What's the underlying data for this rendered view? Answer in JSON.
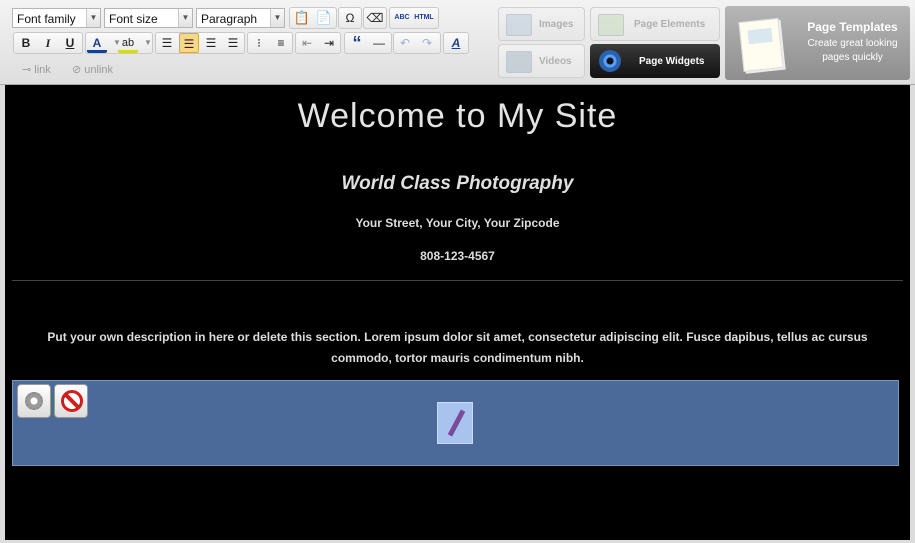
{
  "toolbar": {
    "font_family": "Font family",
    "font_size": "Font size",
    "block_format": "Paragraph",
    "html_label": "HTML",
    "abc_label": "ABC",
    "bold": "B",
    "italic": "I",
    "underline": "U",
    "font_color": "A",
    "highlight": "ab",
    "blockquote": "“",
    "hr": "—",
    "clean": "A",
    "link": "link",
    "unlink": "unlink"
  },
  "panels": {
    "images": "Images",
    "videos": "Videos",
    "page_elements": "Page Elements",
    "page_widgets": "Page Widgets",
    "templates_title": "Page Templates",
    "templates_desc": "Create great looking pages quickly"
  },
  "page": {
    "title": "Welcome to My Site",
    "subtitle": "World Class Photography",
    "address": "Your Street, Your City, Your Zipcode",
    "phone": "808-123-4567",
    "description": "Put your own description in here or delete this section. Lorem ipsum dolor sit amet, consectetur adipiscing elit. Fusce dapibus, tellus ac cursus commodo, tortor mauris condimentum nibh."
  },
  "colors": {
    "canvas_bg": "#000000",
    "widget_bg": "#4b6a9a",
    "active_button": "#f5d98b"
  }
}
